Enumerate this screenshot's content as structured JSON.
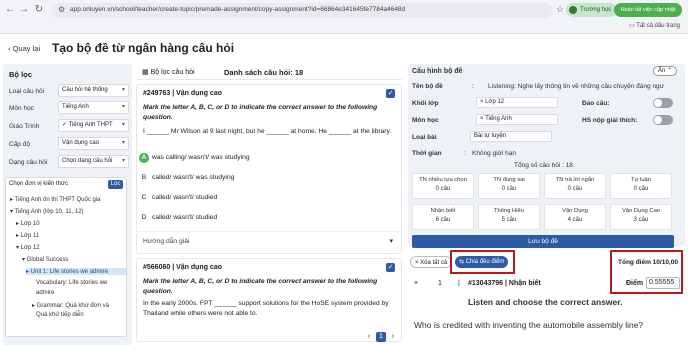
{
  "browser": {
    "url": "app.onluyen.vn/school/teacher/create-topic/premade-assignment/copy-assignment?id=66864e341645fe7784a4648d",
    "school_label": "Trường học",
    "finish_label": "Hoàn tất việc cập nhật",
    "bookmarks_label": "Tất cả dấu trang"
  },
  "header": {
    "back_label": "Quay lại",
    "title": "Tạo bộ đề từ ngân hàng câu hỏi"
  },
  "filters": {
    "heading": "Bộ lọc",
    "rows": [
      {
        "label": "Loại câu hỏi",
        "value": "Câu hỏi hệ thống"
      },
      {
        "label": "Môn học",
        "value": "Tiếng Anh"
      },
      {
        "label": "Giáo Trình",
        "value": "✓ Tiếng Anh THPT"
      },
      {
        "label": "Cấp độ",
        "value": "Vận dụng cao"
      },
      {
        "label": "Dạng câu hỏi",
        "value": "Chọn dạng câu hỏi"
      }
    ],
    "tree_heading": "Chọn đơn vị kiến thức",
    "tree_button": "Lọc",
    "tree_items": [
      "▸ Tiếng Anh ôn thi THPT Quốc gia",
      "▾ Tiếng Anh (lớp 10, 11, 12)",
      "▸ Lớp 10",
      "▸ Lớp 11",
      "▾ Lớp 12",
      "▾ Global Success",
      "▸ Unit 1: Life stories we admire",
      "Vocabulary: Life stories we",
      "admire",
      "▸ Grammar: Quá khứ đơn và",
      "Quá khứ tiếp diễn"
    ]
  },
  "middle": {
    "filter_tab": "Bộ lọc câu hỏi",
    "list_title": "Danh sách câu hỏi: 18",
    "q1": {
      "id": "#249763 | Vận dụng cao",
      "instruction": "Mark the letter A, B, C, or D to indicate the correct answer to the following question.",
      "stem": "I ______ Mr Wilson at 9 last night, but he ______ at home. He ______ at the library.",
      "options": [
        {
          "letter": "A",
          "text": "was calling/ wasn't/ was studying"
        },
        {
          "letter": "B",
          "text": "called/ wasn't/ was studying"
        },
        {
          "letter": "C",
          "text": "called/ wasn't/ studied"
        },
        {
          "letter": "D",
          "text": "called/ wasn't/ studied"
        }
      ],
      "guide": "Hướng dẫn giải"
    },
    "q2": {
      "id": "#566060 | Vận dụng cao",
      "instruction": "Mark the letter A, B, C, or D to indicate the correct answer to the following question.",
      "stem": "In the early 2000s, FPT ______ support solutions for the HoSE system provided by Thailand while others were not able to."
    },
    "pages": [
      "‹",
      "1",
      "›"
    ]
  },
  "config": {
    "heading": "Cấu hình bộ đề",
    "collapse_label": "Ẩn",
    "name_label": "Tên bộ đề",
    "name_value": "Listening: Nghe lấy thông tin về những câu chuyện đáng ngư",
    "grade_label": "Khối lớp",
    "grade_value": "Lớp 12",
    "shuffle_label": "Đảo câu:",
    "subject_label": "Môn học",
    "subject_value": "Tiếng Anh",
    "explain_label": "HS nộp giải thích:",
    "type_label": "Loại bài",
    "type_value": "Bài tự luyện",
    "time_label": "Thời gian",
    "time_value": "Không giới hạn",
    "total_label": "Tổng số câu hỏi : 18",
    "types": [
      {
        "name": "TN nhiều lựa chọn",
        "count": "0 câu"
      },
      {
        "name": "TN đúng sai",
        "count": "0 câu"
      },
      {
        "name": "TN trả lời ngắn",
        "count": "0 câu"
      },
      {
        "name": "Tự luận",
        "count": "0 câu"
      }
    ],
    "levels": [
      {
        "name": "Nhận biết",
        "count": "6 câu"
      },
      {
        "name": "Thông Hiểu",
        "count": "5 câu"
      },
      {
        "name": "Vận Dụng",
        "count": "4 câu"
      },
      {
        "name": "Vận Dụng Cao",
        "count": "3 câu"
      }
    ],
    "save_label": "Lưu bộ đề"
  },
  "selected": {
    "remove_all": "Xóa tất cả",
    "split_points": "Chia đều điểm",
    "total_points": "Tổng điểm 10/10,00",
    "row_index": "1",
    "row_id": "#13043796 | Nhận biết",
    "points_label": "Điểm",
    "points_value": "0.55555",
    "prompt": "Listen and choose the correct answer.",
    "question": "Who is credited with inventing the automobile assembly line?"
  }
}
